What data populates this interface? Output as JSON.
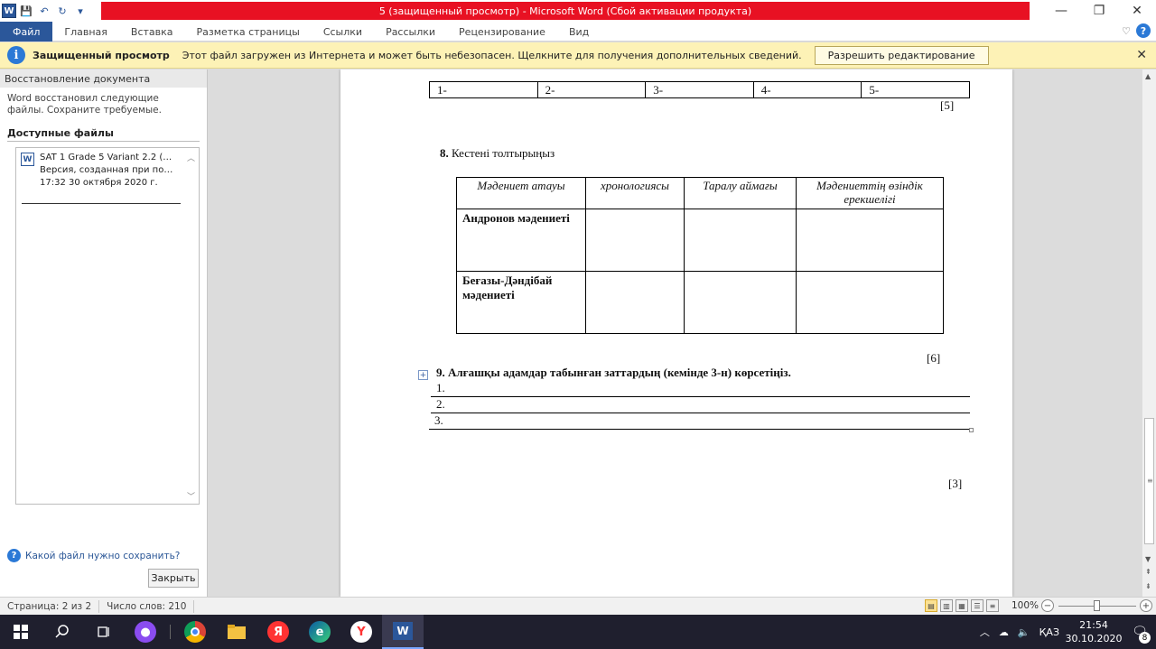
{
  "window": {
    "title": "5 (защищенный просмотр) - Microsoft Word (Сбой активации продукта)",
    "logo_letter": "W",
    "minimize": "—",
    "restore": "❐",
    "close": "✕"
  },
  "qat": {
    "save": "💾",
    "undo": "↶",
    "redo": "↻",
    "customize": "▾"
  },
  "ribbon": {
    "tabs": [
      "Файл",
      "Главная",
      "Вставка",
      "Разметка страницы",
      "Ссылки",
      "Рассылки",
      "Рецензирование",
      "Вид"
    ],
    "minimize_ribbon": "♡",
    "help": "?"
  },
  "protected_view": {
    "title": "Защищенный просмотр",
    "message": "Этот файл загружен из Интернета и может быть небезопасен. Щелкните для получения дополнительных сведений.",
    "enable_button": "Разрешить редактирование",
    "close": "✕"
  },
  "recovery": {
    "header": "Восстановление документа",
    "description": "Word восстановил следующие файлы. Сохраните требуемые.",
    "available_label": "Доступные файлы",
    "file": {
      "name": "SAT 1 Grade 5 Variant 2.2 (1) ...",
      "version": "Версия, созданная при посл...",
      "time": "17:32 30 октября 2020 г."
    },
    "help_link": "Какой файл нужно сохранить?",
    "close_button": "Закрыть"
  },
  "document": {
    "top_table": [
      "1-",
      "2-",
      "3-",
      "4-",
      "5-"
    ],
    "score_5": "[5]",
    "q8_number": "8.",
    "q8_text": " Кестені толтырыңыз",
    "q8_headers": [
      "Мәдениет атауы",
      "хронологиясы",
      "Таралу аймағы",
      "Мәдениеттің өзіндік ерекшелігі"
    ],
    "q8_rows": [
      [
        "Андронов мәдениеті",
        "",
        "",
        ""
      ],
      [
        "Беғазы-Дәндібай мәдениеті",
        "",
        "",
        ""
      ]
    ],
    "score_6": "[6]",
    "q9_number": "9.",
    "q9_text": " Алғашқы адамдар табынған  заттардың (кемінде 3-н) көрсетіңіз.",
    "answers": [
      "1.",
      "2.",
      "3."
    ],
    "score_3": "[3]"
  },
  "statusbar": {
    "page": "Страница: 2 из 2",
    "words": "Число слов: 210",
    "zoom": "100%",
    "zoom_level_percent": 100
  },
  "taskbar": {
    "language": "ҚАЗ",
    "time": "21:54",
    "date": "30.10.2020",
    "notifications_count": "8",
    "yandex_letter": "Я",
    "ybrowser_letter": "Y"
  },
  "colors": {
    "title_bar_red": "#e81123",
    "file_tab_blue": "#2b579a",
    "protected_bar_yellow": "#fdf2b6"
  }
}
